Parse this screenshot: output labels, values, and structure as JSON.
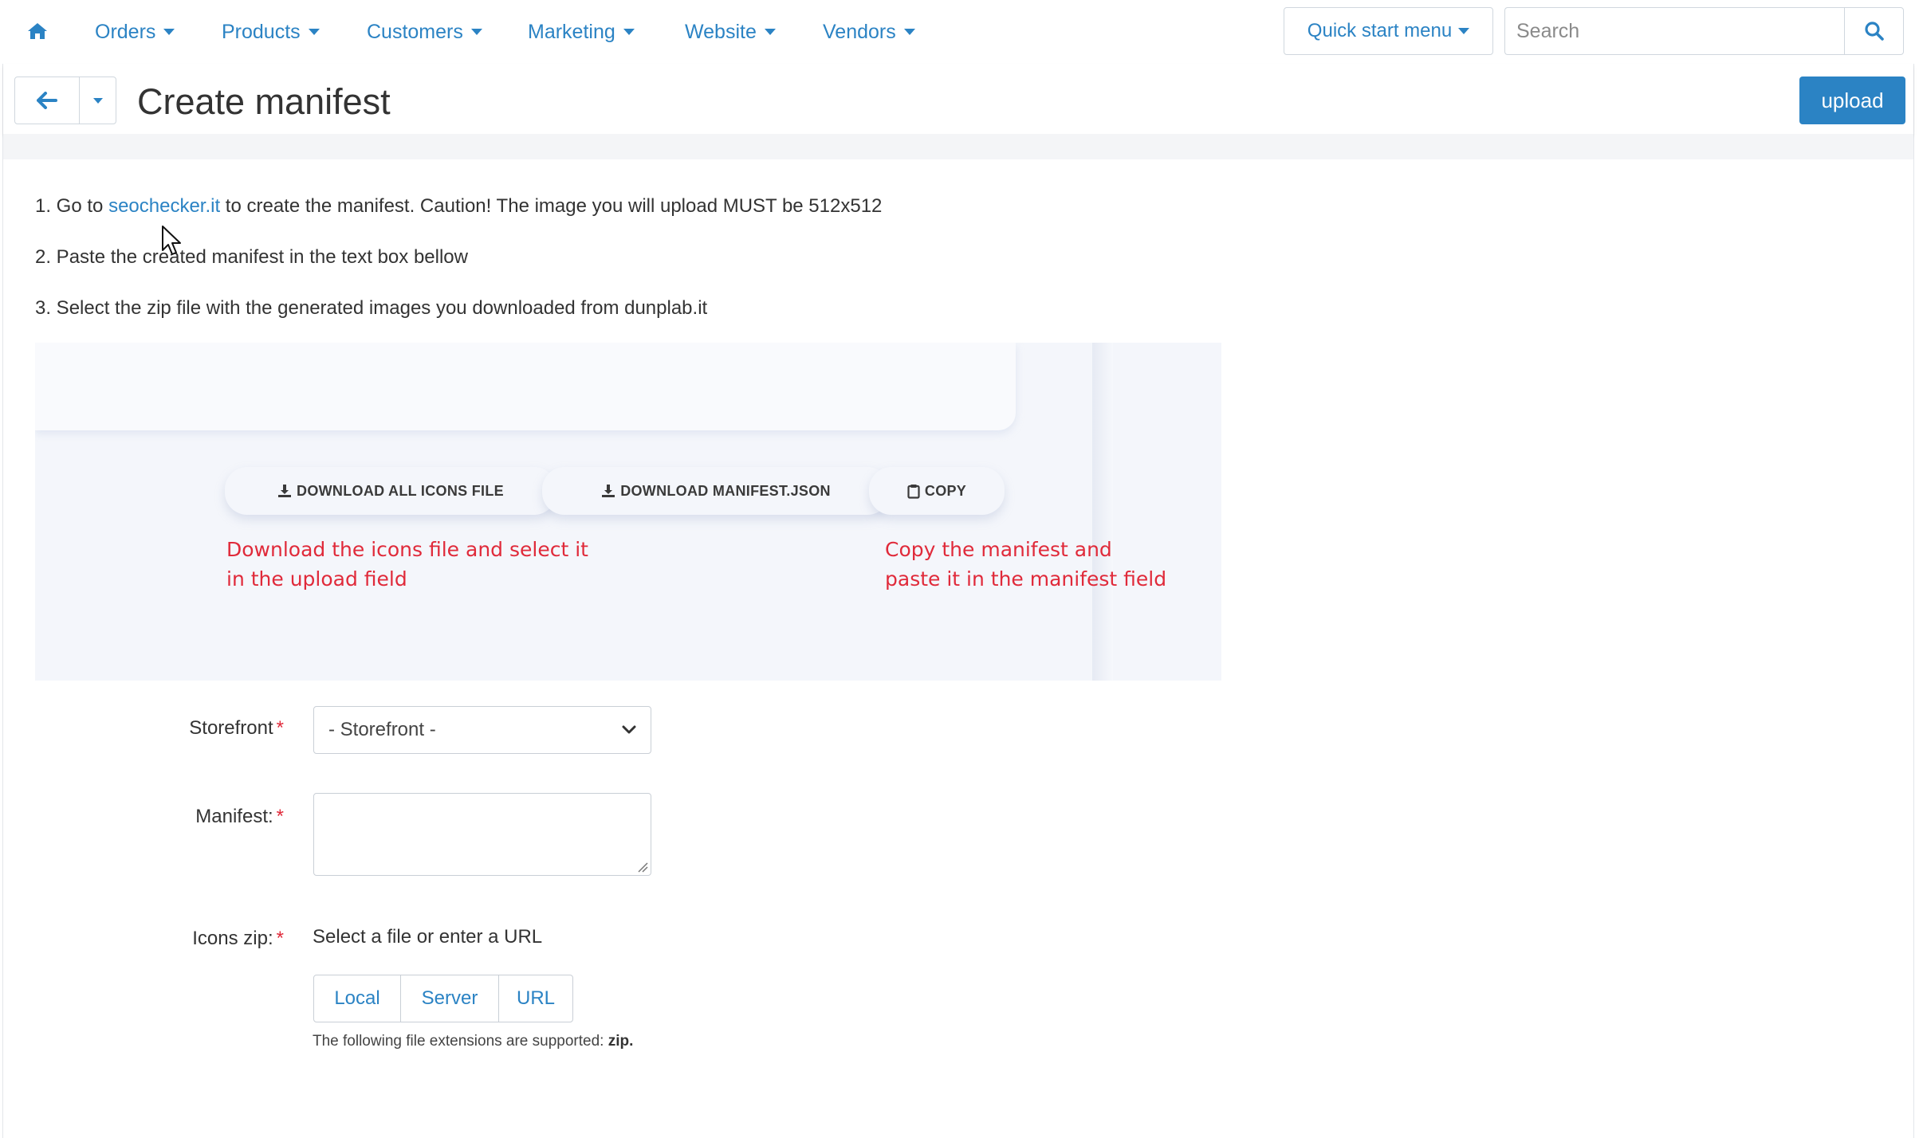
{
  "nav": {
    "items": [
      {
        "label": "Orders"
      },
      {
        "label": "Products"
      },
      {
        "label": "Customers"
      },
      {
        "label": "Marketing"
      },
      {
        "label": "Website"
      },
      {
        "label": "Vendors"
      }
    ],
    "quick_start_label": "Quick start menu",
    "search_placeholder": "Search"
  },
  "header": {
    "title": "Create manifest",
    "upload_label": "upload"
  },
  "instructions": {
    "line1_prefix": "1. Go to ",
    "line1_link": "seochecker.it",
    "line1_suffix": " to create the manifest. Caution! The image you will upload MUST be 512x512",
    "line2": "2. Paste the created manifest in the text box bellow",
    "line3": "3. Select the zip file with the generated images you downloaded from dunplab.it"
  },
  "example_image": {
    "btn_download_icons": "DOWNLOAD ALL ICONS FILE",
    "btn_download_manifest": "DOWNLOAD MANIFEST.JSON",
    "btn_copy": "COPY",
    "note_left_1": "Download the icons file and select it",
    "note_left_2": "in the upload field",
    "note_right_1": "Copy the manifest and",
    "note_right_2": "paste it in the manifest field"
  },
  "form": {
    "storefront_label": "Storefront",
    "storefront_value": "- Storefront -",
    "manifest_label": "Manifest:",
    "icons_label": "Icons zip:",
    "required_mark": "*",
    "file_hint": "Select a file or enter a URL",
    "file_sources": [
      "Local",
      "Server",
      "URL"
    ],
    "ext_prefix": "The following file extensions are supported: ",
    "ext_value": "zip."
  },
  "colors": {
    "accent": "#2b83c4",
    "required": "#e02a3a",
    "note_red": "#e02a3a"
  },
  "icons": {
    "home": "home-icon",
    "search": "search-icon",
    "back": "arrow-left-icon",
    "download": "download-icon",
    "copy": "clipboard-icon",
    "cursor": "mouse-pointer-icon"
  }
}
